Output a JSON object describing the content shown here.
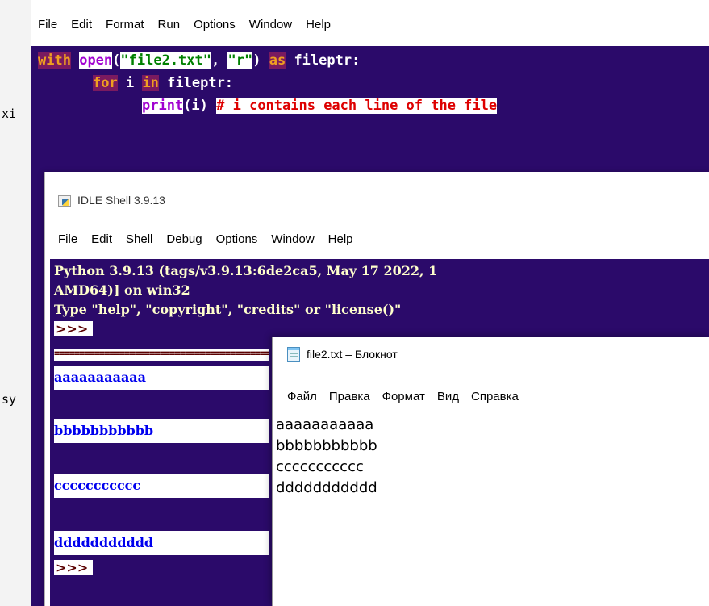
{
  "background": {
    "fragments": [
      "xi",
      "sy"
    ]
  },
  "editor": {
    "menu": [
      "File",
      "Edit",
      "Format",
      "Run",
      "Options",
      "Window",
      "Help"
    ],
    "code": {
      "line1": {
        "kw_with": "with",
        "builtin_open": "open",
        "paren_open": "(",
        "str_file": "\"file2.txt\"",
        "comma": ", ",
        "str_mode": "\"r\"",
        "paren_close": ")",
        "kw_as": "as",
        "name": "fileptr:"
      },
      "line2": {
        "kw_for": "for",
        "var": " i ",
        "kw_in": "in",
        "name": " fileptr:"
      },
      "line3": {
        "builtin_print": "print",
        "args": "(i) ",
        "comment": "# i contains each line of the file"
      }
    }
  },
  "shell": {
    "title": "IDLE Shell 3.9.13",
    "menu": [
      "File",
      "Edit",
      "Shell",
      "Debug",
      "Options",
      "Window",
      "Help"
    ],
    "banner": [
      "Python 3.9.13 (tags/v3.9.13:6de2ca5, May 17 2022, 1",
      "AMD64)] on win32",
      "Type \"help\", \"copyright\", \"credits\" or \"license()\""
    ],
    "prompt": ">>>",
    "restart_marker": "==================================================",
    "output": [
      "aaaaaaaaaaa",
      "bbbbbbbbbbb",
      "ccccccccccc",
      "ddddddddddd"
    ]
  },
  "notepad": {
    "title": "file2.txt – Блокнот",
    "menu": [
      "Файл",
      "Правка",
      "Формат",
      "Вид",
      "Справка"
    ],
    "lines": [
      "aaaaaaaaaaa",
      "bbbbbbbbbbb",
      "ccccccccccc",
      "ddddddddddd"
    ]
  }
}
